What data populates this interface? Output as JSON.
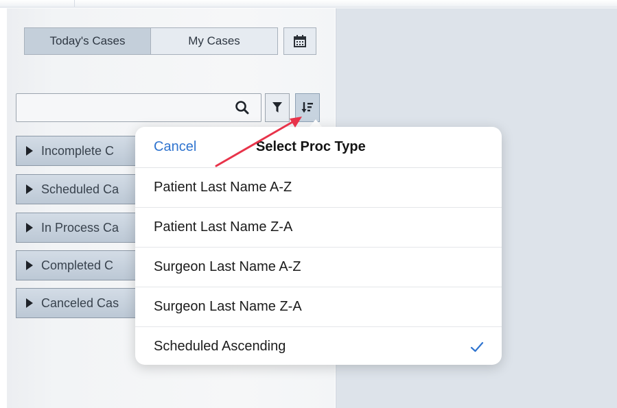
{
  "segmented": {
    "todays_cases": "Today's Cases",
    "my_cases": "My Cases"
  },
  "search": {
    "placeholder": ""
  },
  "categories": [
    {
      "label": "Incomplete C"
    },
    {
      "label": "Scheduled Ca"
    },
    {
      "label": "In Process Ca"
    },
    {
      "label": "Completed C"
    },
    {
      "label": "Canceled Cas"
    }
  ],
  "popover": {
    "cancel": "Cancel",
    "title": "Select Proc Type",
    "options": [
      {
        "label": "Patient Last Name A-Z",
        "selected": false
      },
      {
        "label": "Patient Last Name Z-A",
        "selected": false
      },
      {
        "label": "Surgeon Last Name A-Z",
        "selected": false
      },
      {
        "label": "Surgeon Last Name Z-A",
        "selected": false
      },
      {
        "label": "Scheduled Ascending",
        "selected": true
      }
    ]
  },
  "colors": {
    "accent": "#2f74cf",
    "annotation_arrow": "#e8334a"
  }
}
